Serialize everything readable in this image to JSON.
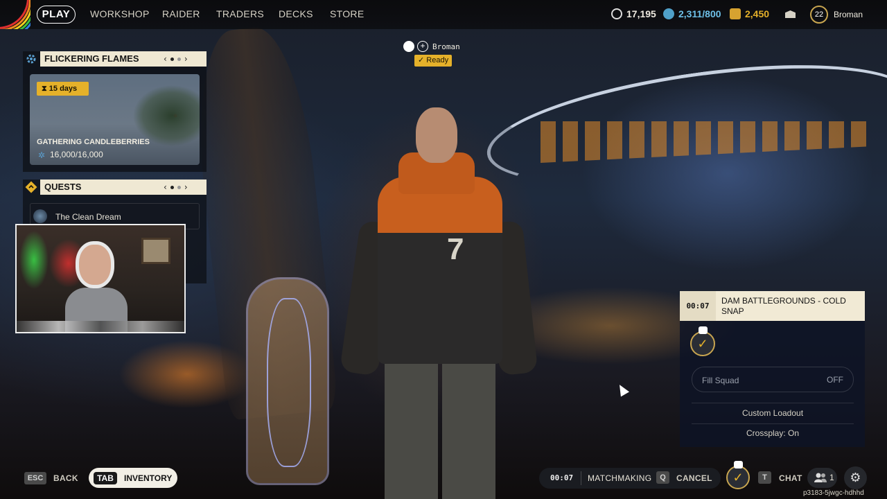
{
  "nav": {
    "play": "PLAY",
    "workshop": "WORKSHOP",
    "raider": "RAIDER",
    "traders": "TRADERS",
    "decks": "DECKS",
    "store": "STORE"
  },
  "currencies": {
    "coins": "17,195",
    "tickets": "2,311/800",
    "credits": "2,450"
  },
  "player": {
    "level": "22",
    "name": "Broman"
  },
  "event": {
    "header": "FLICKERING FLAMES",
    "days": "15 days",
    "title": "GATHERING CANDLEBERRIES",
    "progress": "16,000/16,000"
  },
  "quests": {
    "header": "QUESTS",
    "item1": "The Clean Dream"
  },
  "pager": {
    "prev": "‹",
    "next": "›"
  },
  "squad_tag": {
    "name": "Broman",
    "status": "Ready"
  },
  "matchmaking_panel": {
    "timer": "00:07",
    "map": "DAM BATTLEGROUNDS - COLD SNAP",
    "fill_squad_label": "Fill Squad",
    "fill_squad_value": "OFF",
    "custom_loadout": "Custom Loadout",
    "crossplay": "Crossplay: On"
  },
  "bottom": {
    "esc_key": "ESC",
    "back": "BACK",
    "tab_key": "TAB",
    "inventory": "INVENTORY",
    "timer": "00:07",
    "matchmaking": "MATCHMAKING",
    "q_key": "Q",
    "cancel": "CANCEL",
    "t_key": "T",
    "chat": "CHAT",
    "friends_count": "1",
    "session_id": "p3183-5jwgc-hdhhd"
  },
  "colors": {
    "accent_gold": "#e5b12a",
    "panel_cream": "#efe8d3",
    "panel_dark": "#0e1426"
  },
  "icons": {
    "currency_coins": "coin-icon",
    "currency_tickets": "ticket-icon",
    "currency_credits": "credits-icon",
    "mail": "mail-icon",
    "settings": "gear-icon",
    "friends": "friends-icon"
  }
}
